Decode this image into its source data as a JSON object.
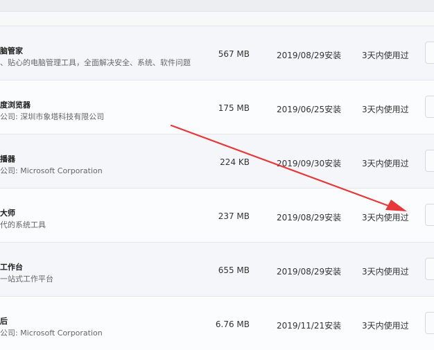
{
  "accent_color": "#e8393a",
  "apps": [
    {
      "name": "脑管家",
      "desc": "、贴心的电脑管理工具，全面解决安全、系统、软件问题",
      "size": "567 MB",
      "installed": "2019/08/29安装",
      "last_used": "3天内使用过"
    },
    {
      "name": "度浏览器",
      "desc": "公司: 深圳市象塔科技有限公司",
      "size": "175 MB",
      "installed": "2019/06/25安装",
      "last_used": "3天内使用过"
    },
    {
      "name": "播器",
      "desc": "公司: Microsoft Corporation",
      "size": "224 KB",
      "installed": "2019/09/30安装",
      "last_used": "3天内使用过"
    },
    {
      "name": "大师",
      "desc": "代的系统工具",
      "size": "237 MB",
      "installed": "2019/08/29安装",
      "last_used": "3天内使用过"
    },
    {
      "name": "工作台",
      "desc": "一站式工作平台",
      "size": "655 MB",
      "installed": "2019/08/29安装",
      "last_used": "3天内使用过"
    },
    {
      "name": "后",
      "desc": "公司: Microsoft Corporation",
      "size": "6.76 MB",
      "installed": "2019/11/21安装",
      "last_used": "3天内使用过"
    }
  ]
}
